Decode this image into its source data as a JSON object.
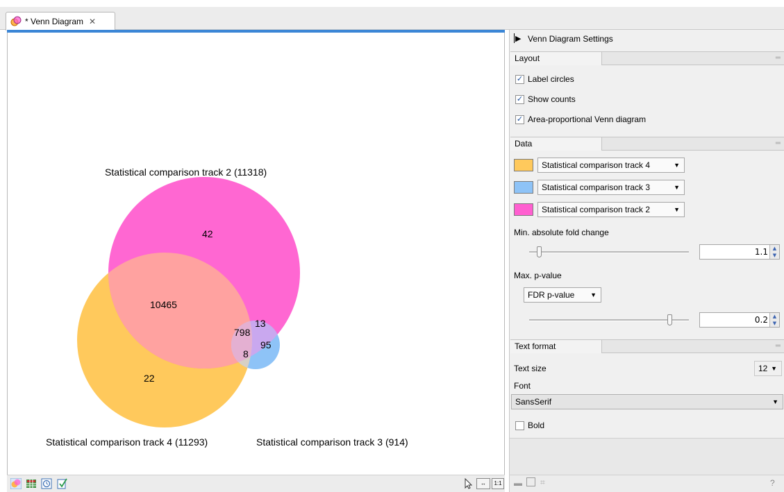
{
  "tab": {
    "title": "* Venn Diagram",
    "close_glyph": "✕",
    "icon": "venn-icon"
  },
  "venn": {
    "circles": [
      {
        "name": "Statistical comparison track 2",
        "label": "Statistical comparison track 2 (11318)",
        "total": 11318,
        "color": "#ff5fd0"
      },
      {
        "name": "Statistical comparison track 4",
        "label": "Statistical comparison track 4 (11293)",
        "total": 11293,
        "color": "#ffc95c"
      },
      {
        "name": "Statistical comparison track 3",
        "label": "Statistical comparison track 3 (914)",
        "total": 914,
        "color": "#8ec3f7"
      }
    ],
    "region_counts": {
      "track2_only": "42",
      "track2_track4": "10465",
      "track4_only": "22",
      "track2_track3": "13",
      "all_three": "798",
      "track3_only": "95",
      "track4_track3": "8"
    }
  },
  "editor_toolbar": {
    "view_icons": [
      "venn-view-icon",
      "table-view-icon",
      "history-icon",
      "checklist-icon"
    ],
    "right_tools": [
      "select-cursor-icon",
      "fit-width-icon",
      "actual-size-icon"
    ],
    "fit_width_text": "↔",
    "actual_size_text": "1:1"
  },
  "panel": {
    "title": "Venn Diagram Settings",
    "layout": {
      "header": "Layout",
      "label_circles": {
        "label": "Label circles",
        "checked": true
      },
      "show_counts": {
        "label": "Show counts",
        "checked": true
      },
      "area_proportional": {
        "label": "Area-proportional Venn diagram",
        "checked": true
      }
    },
    "data": {
      "header": "Data",
      "tracks": [
        {
          "name": "Statistical comparison track 4",
          "color": "#ffc95c"
        },
        {
          "name": "Statistical comparison track 3",
          "color": "#8ec3f7"
        },
        {
          "name": "Statistical comparison track 2",
          "color": "#ff5fd0"
        }
      ],
      "min_fold_change": {
        "label": "Min. absolute fold change",
        "value": "1.1",
        "slider_fraction": 0.06
      },
      "max_pvalue": {
        "label": "Max. p-value",
        "type": "FDR p-value",
        "value": "0.2",
        "slider_fraction": 0.88
      }
    },
    "text_format": {
      "header": "Text format",
      "text_size_label": "Text size",
      "text_size_value": "12",
      "font_label": "Font",
      "font_value": "SansSerif",
      "bold": {
        "label": "Bold",
        "checked": false
      }
    },
    "bottom_help": "?"
  }
}
